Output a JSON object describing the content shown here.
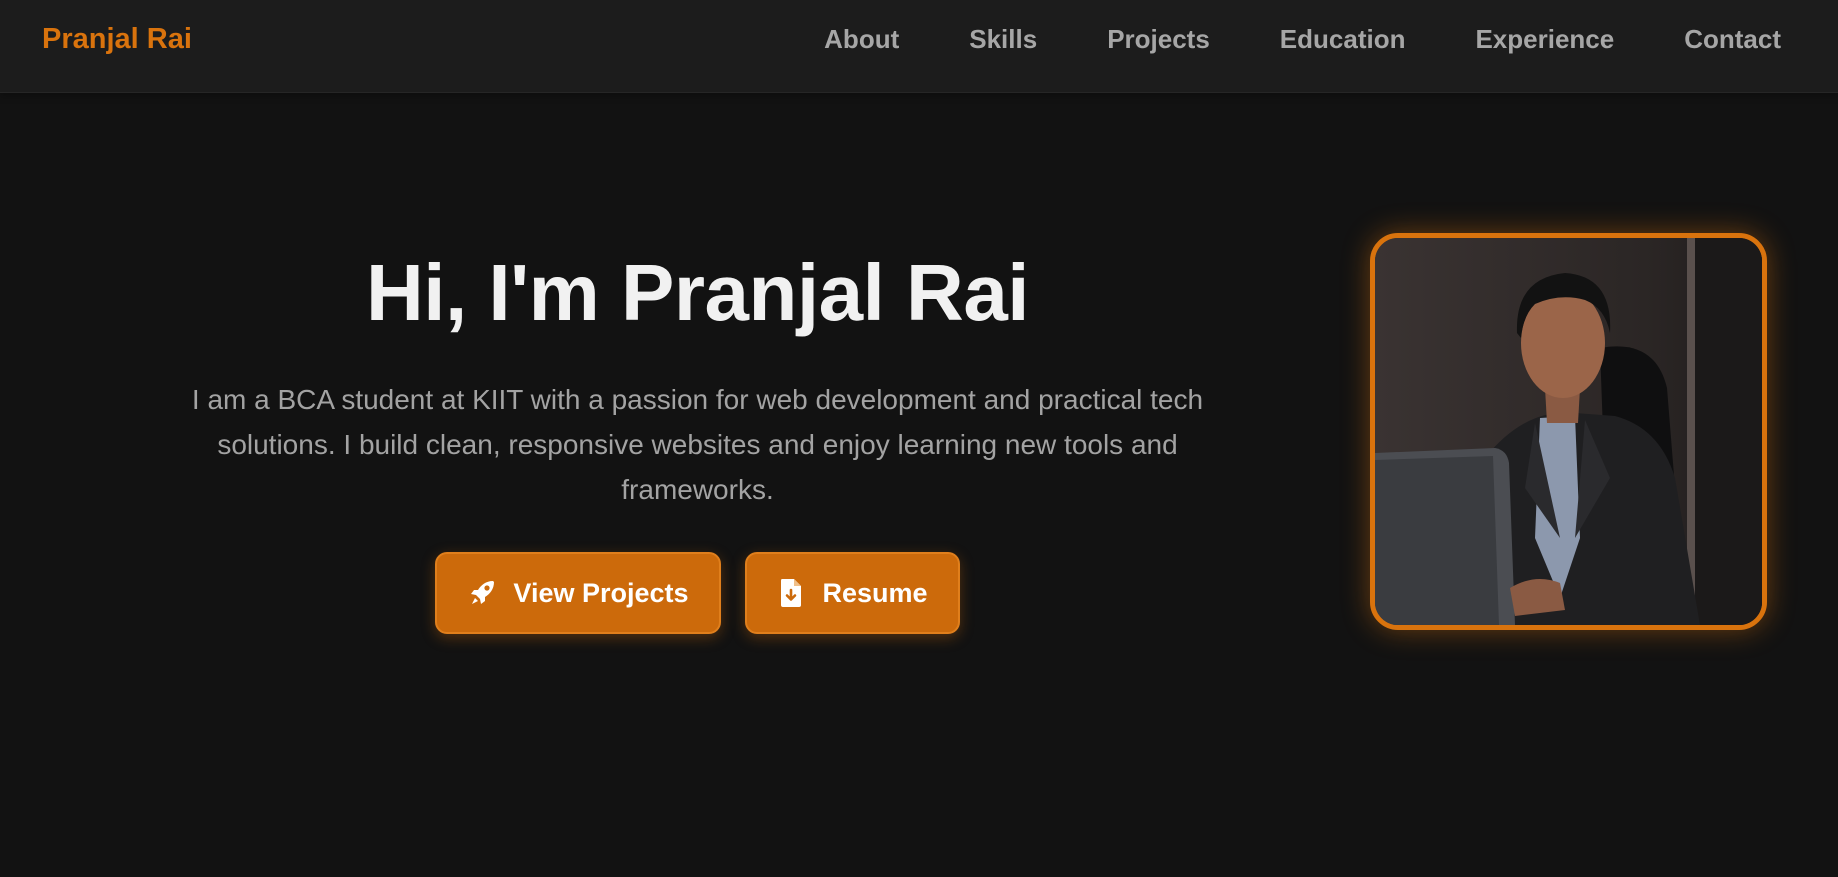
{
  "header": {
    "brand": "Pranjal Rai",
    "nav": [
      "About",
      "Skills",
      "Projects",
      "Education",
      "Experience",
      "Contact"
    ]
  },
  "hero": {
    "title": "Hi, I'm Pranjal Rai",
    "description": "I am a BCA student at KIIT with a passion for web development and practical tech solutions. I build clean, responsive websites and enjoy learning new tools and frameworks.",
    "buttons": {
      "view_projects": {
        "label": "View Projects",
        "icon": "rocket-icon"
      },
      "resume": {
        "label": "Resume",
        "icon": "file-download-icon"
      }
    }
  },
  "colors": {
    "accent": "#d9730d",
    "background": "#121212",
    "navbar": "#1c1c1c",
    "heading": "#f1f1f1",
    "text": "#a3a3a3"
  }
}
